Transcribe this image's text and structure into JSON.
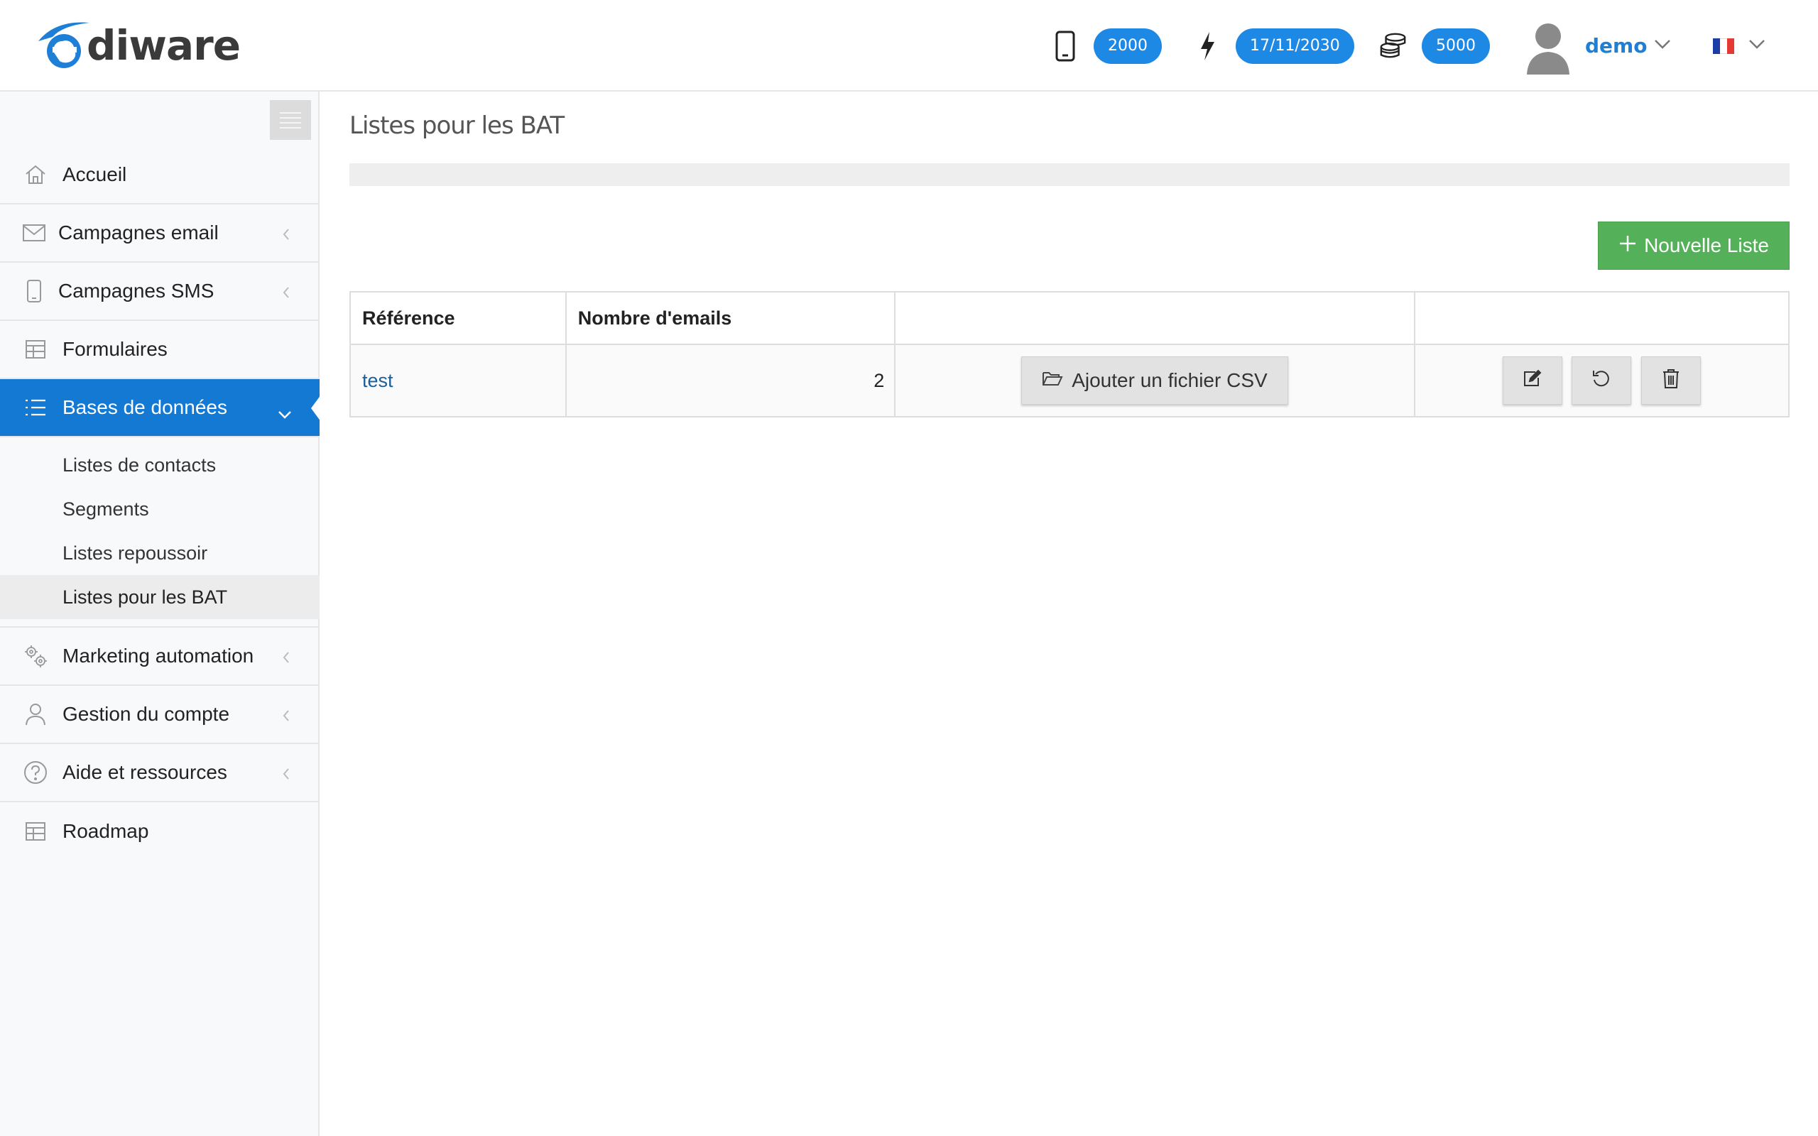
{
  "app": {
    "logo_text": "diware",
    "logo_letter": "e",
    "brand_color": "#1e7fd6"
  },
  "header": {
    "sms_credits": "2000",
    "expiry_date": "17/11/2030",
    "email_credits": "5000",
    "user_name": "demo",
    "language_flag": "fr-flag-icon"
  },
  "sidebar": {
    "items": [
      {
        "label": "Accueil",
        "icon": "home-icon"
      },
      {
        "label": "Campagnes email",
        "icon": "envelope-icon"
      },
      {
        "label": "Campagnes SMS",
        "icon": "mobile-icon"
      },
      {
        "label": "Formulaires",
        "icon": "table-icon"
      },
      {
        "label": "Bases de données",
        "icon": "list-icon"
      },
      {
        "label": "Marketing automation",
        "icon": "gears-icon"
      },
      {
        "label": "Gestion du compte",
        "icon": "user-icon"
      },
      {
        "label": "Aide et ressources",
        "icon": "question-icon"
      },
      {
        "label": "Roadmap",
        "icon": "table-icon"
      }
    ],
    "submenu": [
      {
        "label": "Listes de contacts"
      },
      {
        "label": "Segments"
      },
      {
        "label": "Listes repoussoir"
      },
      {
        "label": "Listes pour les BAT"
      }
    ],
    "active_color": "#1479d2"
  },
  "main": {
    "title": "Listes pour les BAT",
    "new_button": "Nouvelle Liste",
    "new_button_color": "#55b05a",
    "table": {
      "headers": [
        "Référence",
        "Nombre d'emails",
        "",
        ""
      ],
      "rows": [
        {
          "reference": "test",
          "count": "2",
          "csv_button": "Ajouter un fichier CSV"
        }
      ]
    }
  }
}
